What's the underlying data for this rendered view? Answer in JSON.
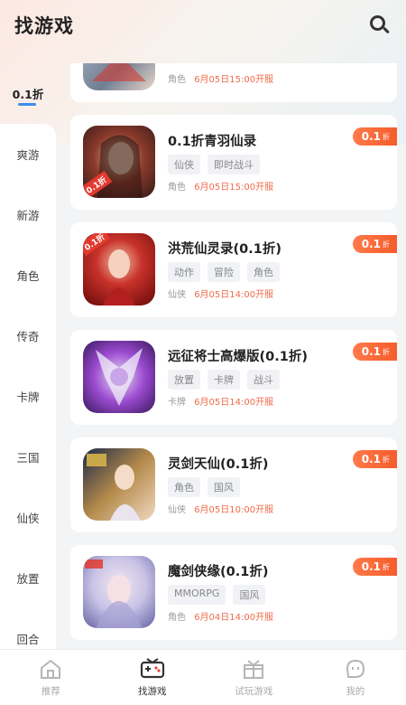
{
  "header": {
    "title": "找游戏"
  },
  "sidebar": {
    "items": [
      {
        "label": "0.1折",
        "active": true
      },
      {
        "label": "爽游"
      },
      {
        "label": "新游"
      },
      {
        "label": "角色"
      },
      {
        "label": "传奇"
      },
      {
        "label": "卡牌"
      },
      {
        "label": "三国"
      },
      {
        "label": "仙侠"
      },
      {
        "label": "放置"
      },
      {
        "label": "回合"
      }
    ]
  },
  "games": [
    {
      "name": "",
      "tags": [],
      "category": "角色",
      "date": "6月05日15:00开服",
      "discount": "",
      "colors": [
        "#b9c3cf",
        "#6e7e93",
        "#e9d6c9"
      ]
    },
    {
      "name": "0.1折青羽仙录",
      "tags": [
        "仙侠",
        "即时战斗"
      ],
      "category": "角色",
      "date": "6月05日15:00开服",
      "discount": "0.1",
      "discount_unit": "折",
      "icon_badge": "0.1折",
      "colors": [
        "#3b1d1a",
        "#8b3a2a",
        "#e8c5a8"
      ]
    },
    {
      "name": "洪荒仙灵录(0.1折)",
      "tags": [
        "动作",
        "冒险",
        "角色"
      ],
      "category": "仙侠",
      "date": "6月05日14:00开服",
      "discount": "0.1",
      "discount_unit": "折",
      "icon_badge": "0.1折",
      "colors": [
        "#7a1010",
        "#c8322a",
        "#f3c2a8"
      ]
    },
    {
      "name": "远征将士高爆版(0.1折)",
      "tags": [
        "放置",
        "卡牌",
        "战斗"
      ],
      "category": "卡牌",
      "date": "6月05日14:00开服",
      "discount": "0.1",
      "discount_unit": "折",
      "colors": [
        "#3a1a5e",
        "#9b4ad0",
        "#e6e0f2"
      ]
    },
    {
      "name": "灵剑天仙(0.1折)",
      "tags": [
        "角色",
        "国风"
      ],
      "category": "仙侠",
      "date": "6月05日10:00开服",
      "discount": "0.1",
      "discount_unit": "折",
      "colors": [
        "#1c2a4a",
        "#b48a4a",
        "#f0d8c0"
      ]
    },
    {
      "name": "魔剑侠缘(0.1折)",
      "tags": [
        "MMORPG",
        "国风"
      ],
      "category": "角色",
      "date": "6月04日14:00开服",
      "discount": "0.1",
      "discount_unit": "折",
      "colors": [
        "#6b6aa8",
        "#c9c3e6",
        "#f2e8f0"
      ]
    }
  ],
  "bottom_nav": [
    {
      "label": "推荐",
      "icon": "home-icon"
    },
    {
      "label": "找游戏",
      "icon": "gamepad-icon",
      "active": true
    },
    {
      "label": "试玩游戏",
      "icon": "gift-icon"
    },
    {
      "label": "我的",
      "icon": "smile-icon"
    }
  ],
  "colors": {
    "accent": "#f55c2c",
    "date": "#ef6b4a",
    "active_bar": "#3b8dea"
  }
}
